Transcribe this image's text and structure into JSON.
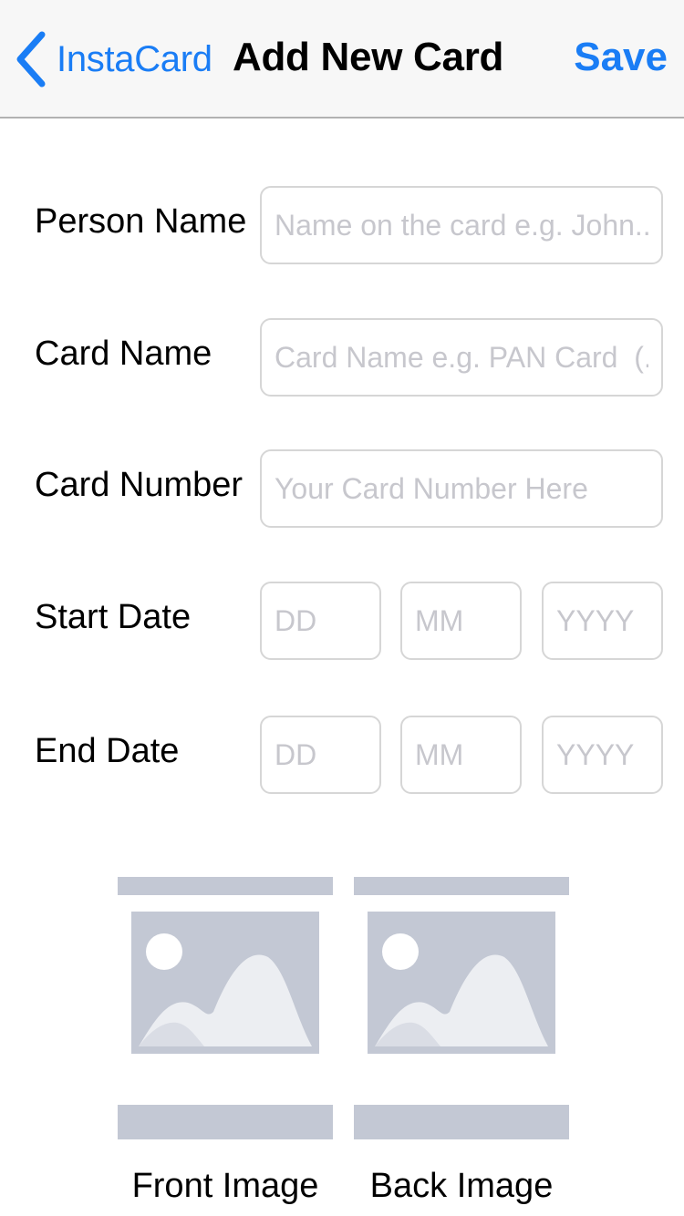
{
  "nav": {
    "back_label": "InstaCard",
    "title": "Add New Card",
    "save_label": "Save"
  },
  "form": {
    "person_name": {
      "label": "Person Name",
      "placeholder": "Name on the card e.g. John...",
      "value": ""
    },
    "card_name": {
      "label": "Card Name",
      "placeholder": "Card Name e.g. PAN Card  (...",
      "value": ""
    },
    "card_number": {
      "label": "Card Number",
      "placeholder": "Your Card Number Here",
      "value": ""
    },
    "start_date": {
      "label": "Start Date",
      "day_placeholder": "DD",
      "month_placeholder": "MM",
      "year_placeholder": "YYYY"
    },
    "end_date": {
      "label": "End Date",
      "day_placeholder": "DD",
      "month_placeholder": "MM",
      "year_placeholder": "YYYY"
    }
  },
  "images": {
    "front_caption": "Front Image",
    "back_caption": "Back Image",
    "icon": "image-placeholder-icon"
  },
  "colors": {
    "accent": "#1a7df5",
    "placeholder_text": "#c7c7cd",
    "field_border": "#d6d6d6",
    "image_placeholder": "#c3c8d4"
  }
}
